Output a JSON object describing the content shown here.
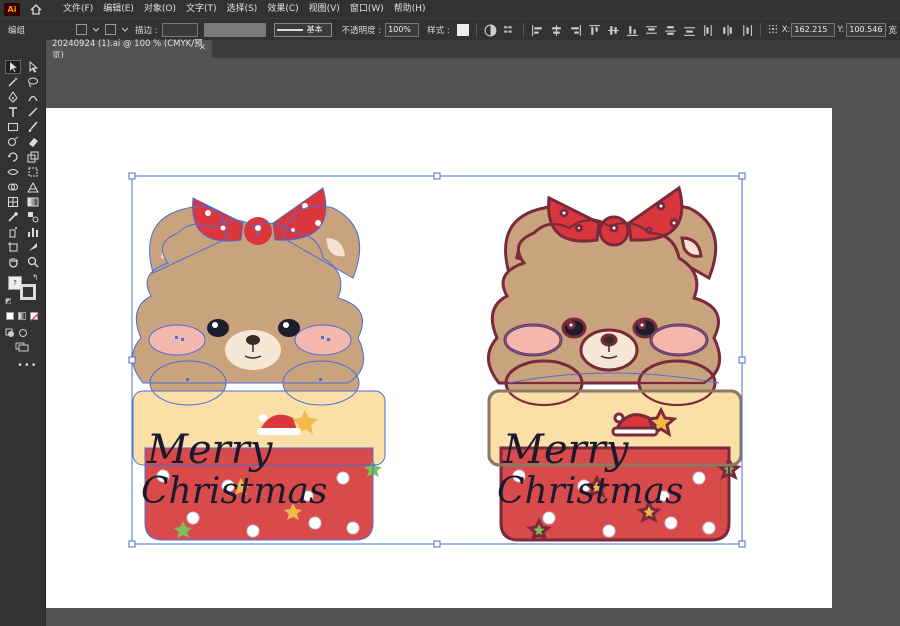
{
  "app": {
    "logo_text": "Ai"
  },
  "menu": [
    "文件(F)",
    "编辑(E)",
    "对象(O)",
    "文字(T)",
    "选择(S)",
    "效果(C)",
    "视图(V)",
    "窗口(W)",
    "帮助(H)"
  ],
  "controlbar": {
    "mode_label": "编组",
    "stroke_label": "描边 :",
    "stroke_style": "基本",
    "opacity_label": "不透明度 :",
    "opacity_value": "100%",
    "style_label": "样式 :",
    "x_label": "X:",
    "x_value": "162.215",
    "y_label": "Y:",
    "y_value": "100.546",
    "w_label": "宽"
  },
  "document": {
    "tab_title": "20240924 (1).ai @ 100 % (CMYK/预览)",
    "close_glyph": "✕"
  },
  "artwork": {
    "left_text_line1": "Merry",
    "left_text_line2": "Christmas",
    "right_text_line1": "Merry",
    "right_text_line2": "Christmas"
  },
  "colors": {
    "bear_fur": "#c9a27e",
    "bow_red": "#d9363e",
    "box_cream": "#fbdfa6",
    "box_red": "#d94a4a",
    "selection_blue": "#4a6fd6",
    "outline_dark": "#7a2a3a"
  },
  "icons": [
    "home-icon",
    "selection-tool-icon",
    "direct-selection-tool-icon",
    "pen-tool-icon",
    "type-tool-icon",
    "rectangle-tool-icon",
    "brush-tool-icon",
    "eraser-tool-icon",
    "rotate-tool-icon",
    "scale-tool-icon",
    "eyedropper-tool-icon",
    "gradient-tool-icon",
    "hand-tool-icon",
    "zoom-tool-icon",
    "fill-swatch-icon",
    "stroke-swatch-icon",
    "more-tools-icon"
  ]
}
